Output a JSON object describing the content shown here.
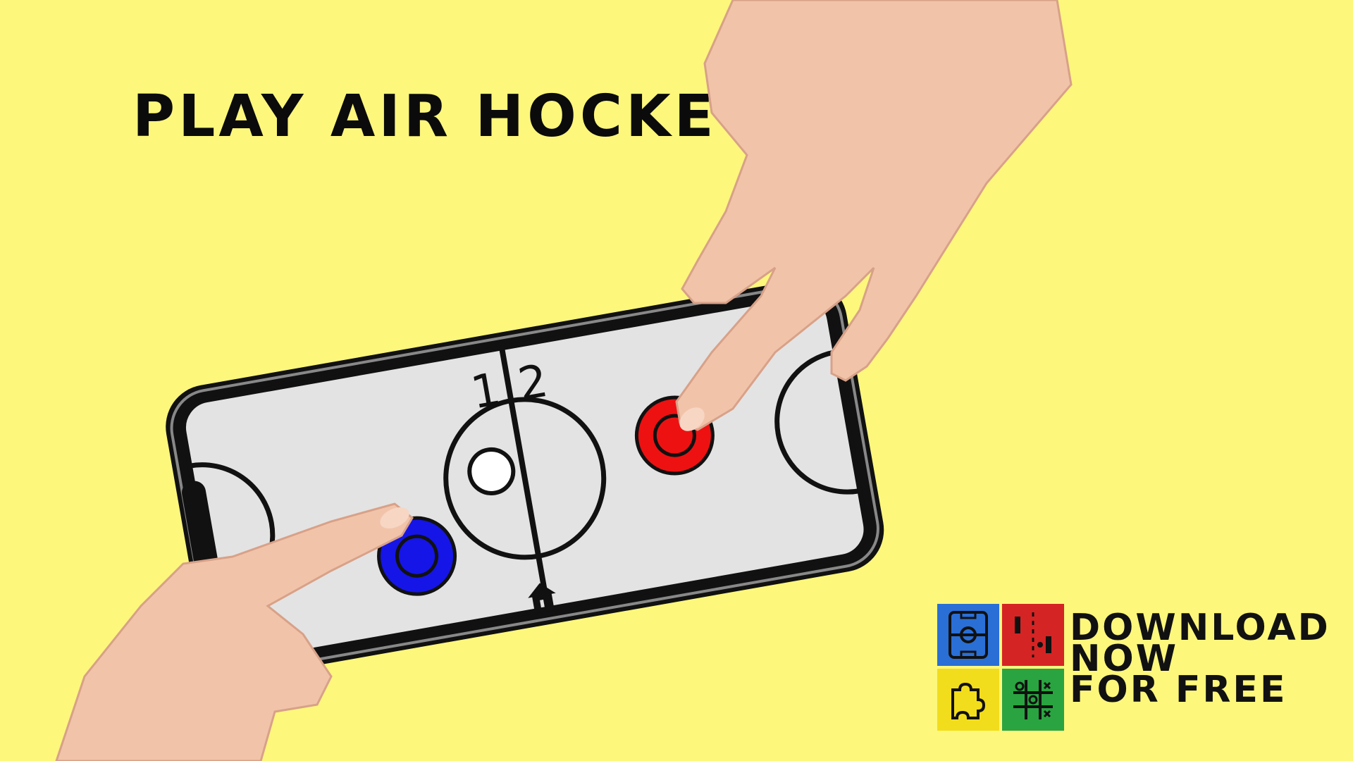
{
  "headline": "PLAY AIR HOCKEY",
  "scoreboard": {
    "left_score": "1",
    "right_score": "2"
  },
  "promo": {
    "line1": "DOWNLOAD",
    "line2": "NOW",
    "line3": "FOR FREE"
  },
  "app_icons": [
    "air-hockey-icon",
    "pong-icon",
    "puzzle-icon",
    "tic-tac-toe-icon"
  ],
  "colors": {
    "background": "#fdf77c",
    "blue_mallet": "#1515e8",
    "red_mallet": "#ee1111",
    "puck": "#ffffff",
    "table": "#e3e3e3",
    "tile_blue": "#2a6fd6",
    "tile_red": "#d52424",
    "tile_yellow": "#f2dd1c",
    "tile_green": "#2aa440"
  }
}
